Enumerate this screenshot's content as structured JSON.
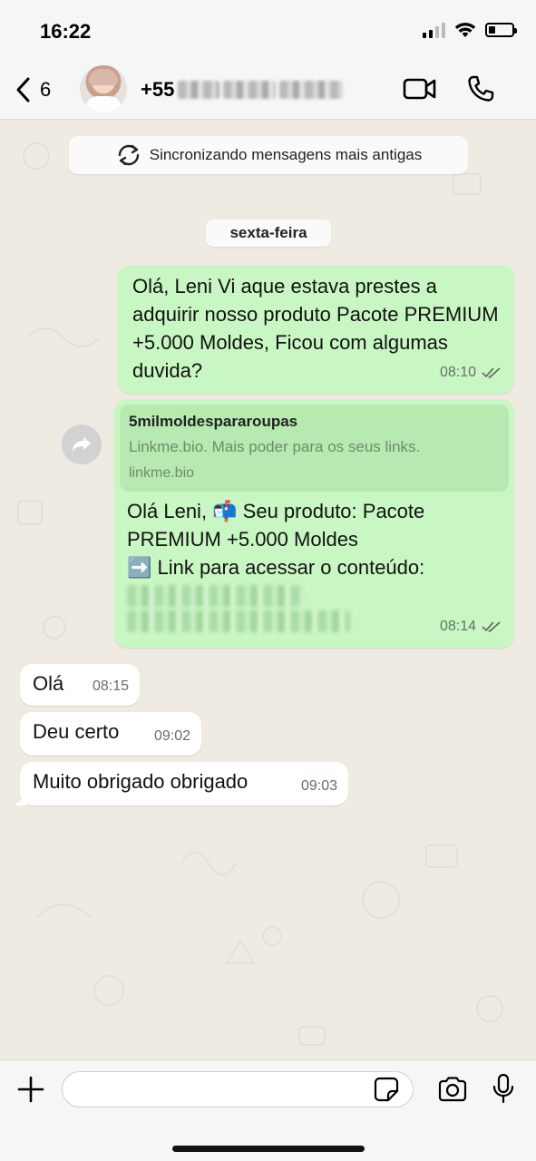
{
  "status_bar": {
    "time": "16:22"
  },
  "header": {
    "back_count": "6",
    "contact_prefix": "+55"
  },
  "chat": {
    "sync_banner": "Sincronizando mensagens mais antigas",
    "day_label": "sexta-feira",
    "messages": [
      {
        "direction": "out",
        "text": "Olá, Leni Vi aque estava prestes a adquirir nosso produto Pacote PREMIUM +5.000 Moldes, Ficou com algumas duvida?",
        "time": "08:10",
        "status": "read"
      },
      {
        "direction": "out",
        "link_preview": {
          "title": "5milmoldespararoupas",
          "description": "Linkme.bio. Mais poder para os seus links.",
          "domain": "linkme.bio"
        },
        "line1": "Olá Leni, 📬 Seu produto: Pacote PREMIUM +5.000 Moldes",
        "line2": "➡️ Link para acessar o conteúdo:",
        "time": "08:14",
        "status": "read"
      },
      {
        "direction": "in",
        "text": "Olá",
        "time": "08:15"
      },
      {
        "direction": "in",
        "text": "Deu certo",
        "time": "09:02"
      },
      {
        "direction": "in",
        "text": "Muito obrigado obrigado",
        "time": "09:03"
      }
    ]
  },
  "input": {
    "placeholder": ""
  },
  "icons": {
    "back": "chevron-left-icon",
    "video": "video-camera-icon",
    "call": "phone-icon",
    "sync": "sync-icon",
    "forward": "forward-icon",
    "plus": "plus-icon",
    "sticker": "sticker-icon",
    "camera": "camera-icon",
    "mic": "microphone-icon"
  },
  "colors": {
    "outgoing_bubble": "#c9f7c4",
    "incoming_bubble": "#ffffff",
    "chat_background": "#efeae2",
    "bar_background": "#f6f6f6"
  }
}
